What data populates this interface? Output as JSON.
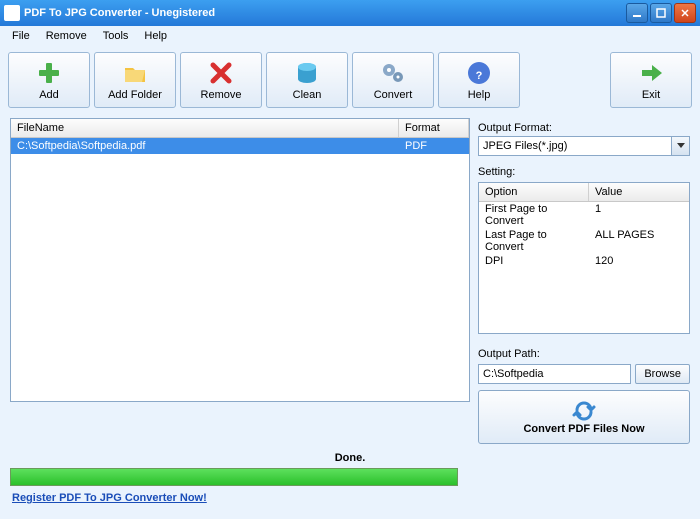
{
  "window": {
    "title": "PDF To JPG Converter - Unegistered"
  },
  "menu": {
    "file": "File",
    "remove": "Remove",
    "tools": "Tools",
    "help": "Help"
  },
  "toolbar": {
    "add": "Add",
    "addFolder": "Add Folder",
    "remove": "Remove",
    "clean": "Clean",
    "convert": "Convert",
    "help": "Help",
    "exit": "Exit"
  },
  "fileTable": {
    "headers": {
      "name": "FileName",
      "format": "Format"
    },
    "rows": [
      {
        "name": "C:\\Softpedia\\Softpedia.pdf",
        "format": "PDF"
      }
    ]
  },
  "outputFormat": {
    "label": "Output Format:",
    "value": "JPEG Files(*.jpg)"
  },
  "settings": {
    "label": "Setting:",
    "headers": {
      "option": "Option",
      "value": "Value"
    },
    "rows": [
      {
        "option": "First Page to Convert",
        "value": "1"
      },
      {
        "option": "Last Page to Convert",
        "value": "ALL PAGES"
      },
      {
        "option": "DPI",
        "value": "120"
      }
    ]
  },
  "outputPath": {
    "label": "Output Path:",
    "value": "C:\\Softpedia",
    "browse": "Browse"
  },
  "status": {
    "text": "Done."
  },
  "convertNow": "Convert PDF Files Now",
  "registerLink": "Register PDF To JPG Converter Now!"
}
